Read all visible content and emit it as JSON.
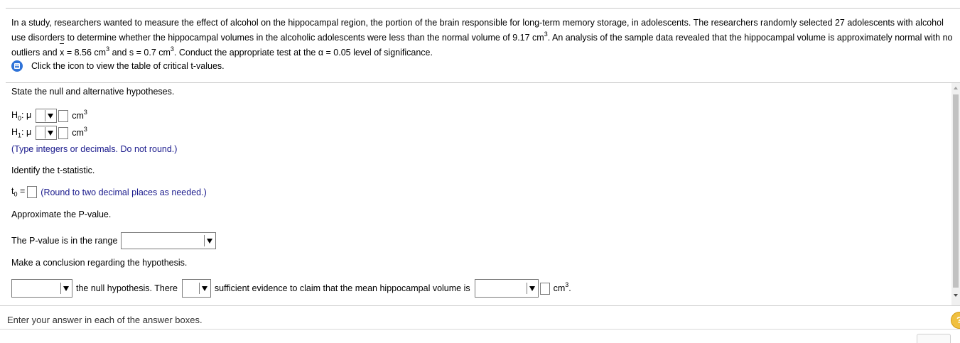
{
  "problem": {
    "part1": "In a study, researchers wanted to measure the effect of alcohol on the hippocampal region, the portion of the brain responsible for long-term memory storage, in adolescents. The researchers randomly selected 27 adolescents with alcohol use disorders to determine whether the hippocampal volumes in the alcoholic adolescents were less than the normal volume of 9.17 cm",
    "part2": ". An analysis of the sample data revealed that the hippocampal volume is approximately normal with no outliers and ",
    "xbar": "x",
    "part3": " = 8.56 cm",
    "part4": " and s = 0.7 cm",
    "part5": ". Conduct the appropriate test at the α = 0.05 level of significance.",
    "superscript": "3"
  },
  "hint": {
    "text": "Click the icon to view the table of critical t-values."
  },
  "question": {
    "state_hypotheses": "State the null and alternative hypotheses.",
    "h0": "H",
    "h0_sub": "0",
    "h1": "H",
    "h1_sub": "1",
    "mu": ": μ",
    "unit": "cm",
    "type_instruction": "(Type integers or decimals. Do not round.)",
    "identify_t": "Identify the t-statistic.",
    "t0": "t",
    "t0_sub": "0",
    "equals": " =",
    "round_instruction": "(Round to two decimal places as needed.)",
    "approx_p": "Approximate the P-value.",
    "p_range_label": "The P-value is in the range",
    "conclusion": "Make a conclusion regarding the hypothesis.",
    "null_hyp_text": "the null hypothesis. There",
    "sufficient_text": "sufficient evidence to claim that the mean hippocampal volume is",
    "unit_period": "cm",
    "superscript": "3"
  },
  "footer": {
    "instruction": "Enter your answer in each of the answer boxes.",
    "help_glyph": "?"
  },
  "colors": {
    "instruction_text": "#1a1a8c",
    "help_icon": "#f0c040",
    "hint_icon": "#2f73d8"
  },
  "icons": {
    "hint": "document-icon",
    "help": "help-icon"
  }
}
